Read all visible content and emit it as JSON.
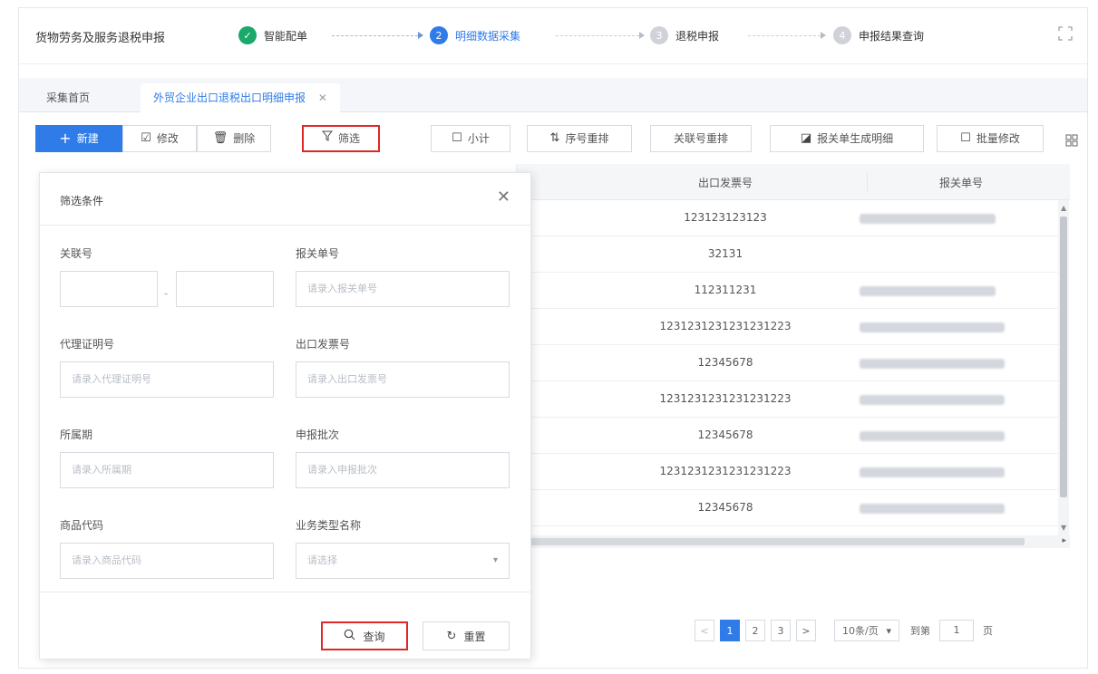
{
  "app": {
    "title": "货物劳务及服务退税申报"
  },
  "steps": [
    {
      "num": "✓",
      "label": "智能配单",
      "state": "done"
    },
    {
      "num": "2",
      "label": "明细数据采集",
      "state": "active"
    },
    {
      "num": "3",
      "label": "退税申报",
      "state": "todo"
    },
    {
      "num": "4",
      "label": "申报结果查询",
      "state": "todo"
    }
  ],
  "tabs": [
    {
      "label": "采集首页"
    },
    {
      "label": "外贸企业出口退税出口明细申报",
      "close": "✕"
    }
  ],
  "toolbar": {
    "new": "新建",
    "edit": "修改",
    "delete": "删除",
    "filter": "筛选",
    "subtotal": "小计",
    "seq_reorder": "序号重排",
    "link_reorder": "关联号重排",
    "generate_detail": "报关单生成明细",
    "batch_edit": "批量修改"
  },
  "table": {
    "headers": [
      "出口发票号",
      "报关单号"
    ],
    "rows": [
      {
        "invoice": "123123123123"
      },
      {
        "invoice": "32131"
      },
      {
        "invoice": "112311231"
      },
      {
        "invoice": "1231231231231231223"
      },
      {
        "invoice": "12345678"
      },
      {
        "invoice": "1231231231231231223"
      },
      {
        "invoice": "12345678"
      },
      {
        "invoice": "1231231231231231223"
      },
      {
        "invoice": "12345678"
      }
    ]
  },
  "pagination": {
    "prev": "<",
    "pages": [
      "1",
      "2",
      "3"
    ],
    "current": "1",
    "next": ">",
    "page_size": "10条/页",
    "goto_label": "到第",
    "goto_value": "1",
    "unit": "页"
  },
  "filter": {
    "title": "筛选条件",
    "close": "✕",
    "fields": {
      "link_no": {
        "label": "关联号"
      },
      "customs_no": {
        "label": "报关单号",
        "placeholder": "请录入报关单号"
      },
      "agent_cert": {
        "label": "代理证明号",
        "placeholder": "请录入代理证明号"
      },
      "export_invoice": {
        "label": "出口发票号",
        "placeholder": "请录入出口发票号"
      },
      "period": {
        "label": "所属期",
        "placeholder": "请录入所属期"
      },
      "batch": {
        "label": "申报批次",
        "placeholder": "请录入申报批次"
      },
      "goods_code": {
        "label": "商品代码",
        "placeholder": "请录入商品代码"
      },
      "biz_type": {
        "label": "业务类型名称",
        "placeholder": "请选择"
      }
    },
    "query": "查询",
    "reset": "重置"
  }
}
